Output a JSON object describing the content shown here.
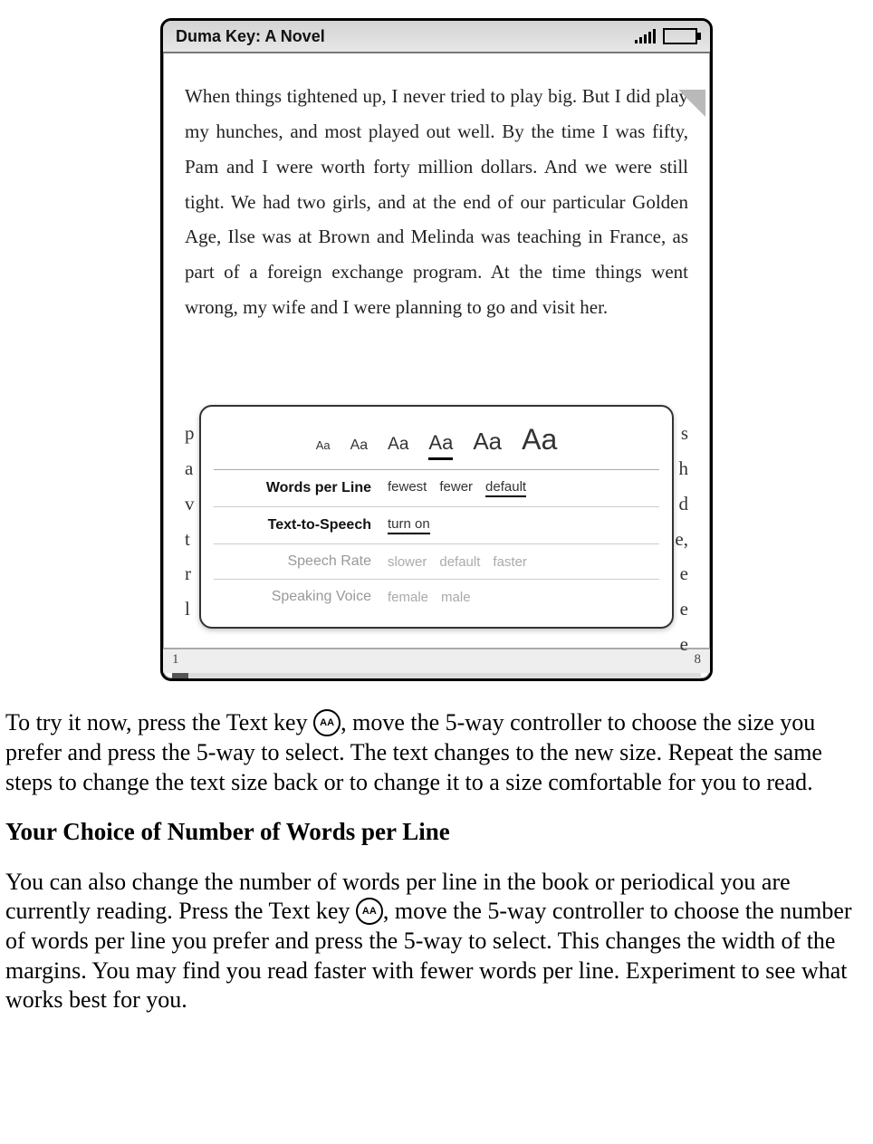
{
  "kindle": {
    "title": "Duma Key: A Novel",
    "paragraph": "When things tightened up, I never tried to play big. But I did play my hunches, and most played out well. By the time I was fifty, Pam and I were worth forty million dollars. And we were still tight. We had two girls, and at the end of our particular Golden Age, Ilse was at Brown and Melinda was teaching in France, as part of a foreign exchange program. At the time things went wrong, my wife and I were planning to go and visit her.",
    "bg": {
      "left": [
        "p",
        "a",
        "v",
        "t",
        "r",
        "l"
      ],
      "right": [
        "s",
        "h",
        "d",
        "e,",
        "e",
        "e",
        "e"
      ]
    },
    "popup": {
      "sizes": [
        "Aa",
        "Aa",
        "Aa",
        "Aa",
        "Aa",
        "Aa"
      ],
      "size_selected_index": 3,
      "rows": {
        "wpl": {
          "label": "Words per Line",
          "opts": [
            "fewest",
            "fewer",
            "default"
          ],
          "sel": 2
        },
        "tts": {
          "label": "Text-to-Speech",
          "opts": [
            "turn on"
          ],
          "sel": 0
        },
        "rate": {
          "label": "Speech Rate",
          "opts": [
            "slower",
            "default",
            "faster"
          ]
        },
        "voice": {
          "label": "Speaking Voice",
          "opts": [
            "female",
            "male"
          ]
        }
      }
    },
    "progress": {
      "left": "1",
      "right": "8"
    }
  },
  "doc": {
    "p1a": "To try it now, press the Text key ",
    "p1b": ", move the 5-way controller to choose the size you prefer and press the 5-way to select. The text changes to the new size. Repeat the same steps to change the text size back or to change it to a size comfortable for you to read.",
    "h1": "Your Choice of Number of Words per Line",
    "p2a": "You can also change the number of words per line in the book or periodical you are currently reading. Press the Text key ",
    "p2b": ", move the 5-way controller to choose the number of words per line you prefer and press the 5-way to select. This changes the width of the margins. You may find you read faster with fewer words per line. Experiment to see what works best for you.",
    "aa": "AA"
  }
}
